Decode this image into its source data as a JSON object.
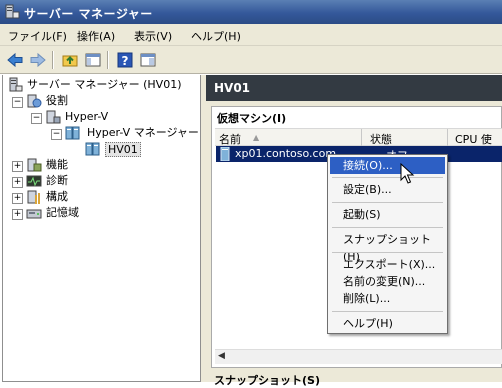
{
  "window": {
    "title": "サーバー マネージャー"
  },
  "menubar": {
    "items": [
      "ファイル(F)",
      "操作(A)",
      "表示(V)",
      "ヘルプ(H)"
    ]
  },
  "toolbar": {
    "icons": [
      "back-arrow-icon",
      "forward-arrow-icon",
      "up-folder-icon",
      "show-hide-tree-icon",
      "help-icon",
      "properties-icon"
    ]
  },
  "tree": {
    "root": "サーバー マネージャー (HV01)",
    "roles": "役割",
    "hyperv": "Hyper-V",
    "hyperv_manager": "Hyper-V マネージャー",
    "hv01": "HV01",
    "features": "機能",
    "diagnostics": "診断",
    "configuration": "構成",
    "storage": "記憶域"
  },
  "main": {
    "header": "HV01",
    "vm_section_title": "仮想マシン(I)",
    "columns": {
      "name": "名前",
      "state": "状態",
      "cpu": "CPU 使用"
    },
    "vm": {
      "name": "xp01.contoso.com",
      "state": "オフ"
    },
    "snapshot_section_title": "スナップショット(S)"
  },
  "context_menu": {
    "connect": "接続(O)...",
    "settings": "設定(B)...",
    "start": "起動(S)",
    "snapshot": "スナップショット(H)",
    "export": "エクスポート(X)...",
    "rename": "名前の変更(N)...",
    "delete": "削除(L)...",
    "help": "ヘルプ(H)"
  },
  "colors": {
    "titlebar": "#34589a",
    "selection": "#0a246a",
    "menu_highlight": "#2d5fc4",
    "header_dark": "#333a42"
  }
}
